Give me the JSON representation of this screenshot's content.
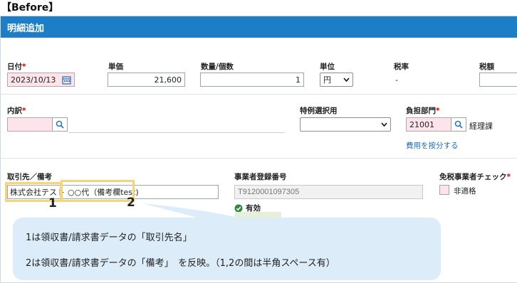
{
  "caption": "【Before】",
  "header": {
    "title": "明細追加"
  },
  "fields": {
    "date": {
      "label": "日付",
      "value": "2023/10/13"
    },
    "unit_price": {
      "label": "単価",
      "value": "21,600"
    },
    "quantity": {
      "label": "数量/個数",
      "value": "1"
    },
    "unit": {
      "label": "単位",
      "value": "円"
    },
    "tax_rate": {
      "label": "税率",
      "value": "-"
    },
    "tax_amount": {
      "label": "税額"
    },
    "breakdown": {
      "label": "内訳"
    },
    "special": {
      "label": "特例選択用"
    },
    "department": {
      "label": "負担部門",
      "code": "21001",
      "name": "経理課",
      "link": "費用を按分する"
    },
    "client_memo": {
      "label": "取引先／備考",
      "value_part1": "株式会社テスト",
      "value_part2": "○○代（備考欄test)"
    },
    "registration": {
      "label": "事業者登録番号",
      "placeholder": "T9120001097305",
      "status": "有効"
    },
    "tax_exempt": {
      "label": "免税事業者チェック",
      "checkbox_label": "非適格"
    }
  },
  "required_mark": "*",
  "annotations": {
    "marker1": "1",
    "marker2": "2"
  },
  "notes": {
    "line1": "1は領収書/請求書データの「取引先名」",
    "line2": "2は領収書/請求書データの「備考」　を反映。（1,2の間は半角スペース有）"
  },
  "colors": {
    "header": "#1c7ec6",
    "required": "#d40000",
    "highlight": "#f4d679",
    "bubble": "#dcecf9",
    "valid": "#2e8b3e"
  }
}
